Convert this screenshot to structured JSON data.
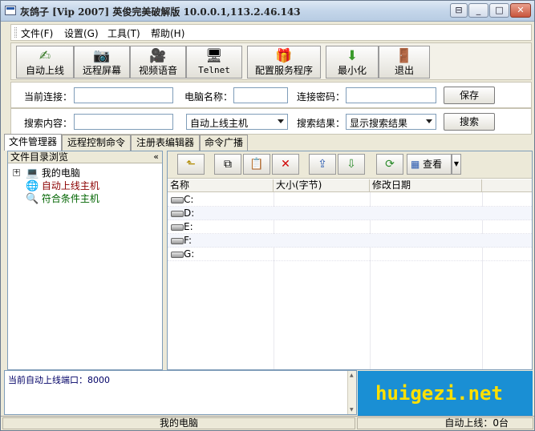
{
  "window": {
    "title": "灰鸽子 [Vip 2007] 英俊完美破解版 10.0.0.1,113.2.46.143"
  },
  "menu": [
    "文件(F)",
    "设置(G)",
    "工具(T)",
    "帮助(H)"
  ],
  "toolbar": [
    {
      "label": "自动上线",
      "icon": "auto-online-icon"
    },
    {
      "label": "远程屏幕",
      "icon": "camera-icon"
    },
    {
      "label": "视频语音",
      "icon": "webcam-icon"
    },
    {
      "label": "Telnet",
      "icon": "computer-icon"
    },
    {
      "label": "配置服务程序",
      "icon": "gift-box-icon"
    },
    {
      "label": "最小化",
      "icon": "down-arrow-icon"
    },
    {
      "label": "退出",
      "icon": "exit-door-icon"
    }
  ],
  "connection": {
    "current_label": "当前连接：",
    "current_value": "",
    "pcname_label": "电脑名称：",
    "pcname_value": "",
    "password_label": "连接密码：",
    "password_value": "",
    "save_label": "保存"
  },
  "search": {
    "content_label": "搜索内容：",
    "content_value": "",
    "scope_value": "自动上线主机",
    "result_label": "搜索结果：",
    "result_value": "显示搜索结果",
    "search_label": "搜索"
  },
  "tabs": [
    "文件管理器",
    "远程控制命令",
    "注册表编辑器",
    "命令广播"
  ],
  "tree": {
    "header": "文件目录浏览",
    "collapse": "«",
    "items": [
      "我的电脑",
      "自动上线主机",
      "符合条件主机"
    ],
    "colors": [
      "#000000",
      "#8b0000",
      "#006400"
    ]
  },
  "file_toolbar": {
    "view_label": "查看"
  },
  "list": {
    "columns": [
      "名称",
      "大小(字节)",
      "修改日期"
    ],
    "rows": [
      "C:",
      "D:",
      "E:",
      "F:",
      "G:"
    ]
  },
  "log": {
    "text": "当前自动上线端口：8000"
  },
  "brand": {
    "text": "huigezi.net",
    "bg": "#1a8fd4",
    "fg": "#ffe000"
  },
  "statusbar": {
    "left": "我的电脑",
    "right": "自动上线：0台"
  }
}
